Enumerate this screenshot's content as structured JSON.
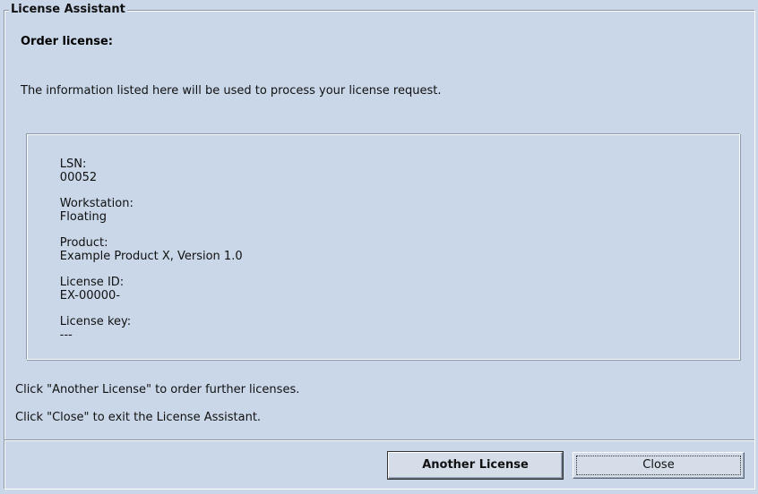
{
  "window": {
    "group_title": "License Assistant"
  },
  "content": {
    "heading": "Order license:",
    "intro": "The information listed here will be used to process your license request."
  },
  "info": {
    "rows": [
      {
        "label": "LSN:",
        "value": "00052"
      },
      {
        "label": "Workstation:",
        "value": "Floating"
      },
      {
        "label": "Product:",
        "value": "Example Product X, Version 1.0"
      },
      {
        "label": "License ID:",
        "value": "EX-00000-"
      },
      {
        "label": "License key:",
        "value": "---"
      }
    ]
  },
  "hints": {
    "another": "Click \"Another License\" to order further licenses.",
    "close": "Click \"Close\" to exit the License Assistant."
  },
  "buttons": {
    "another_license": "Another License",
    "close": "Close"
  },
  "colors": {
    "background": "#c9d7e8",
    "border_dark": "#8a98aa",
    "border_light": "#ffffff"
  }
}
